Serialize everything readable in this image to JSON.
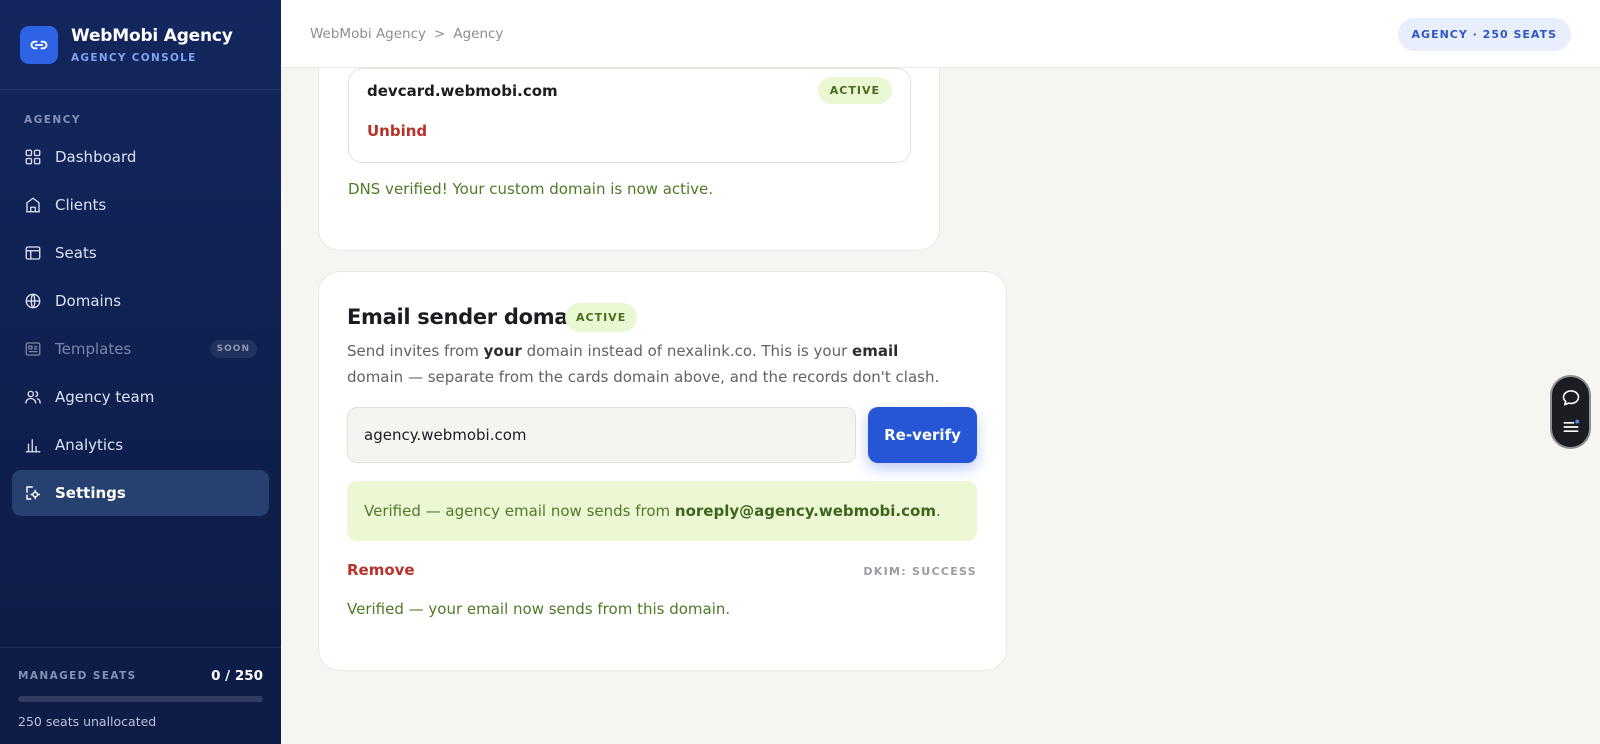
{
  "brand": {
    "name": "WebMobi Agency",
    "subtitle": "AGENCY CONSOLE"
  },
  "sidebar": {
    "section_label": "AGENCY",
    "items": [
      {
        "label": "Dashboard",
        "icon": "grid-icon"
      },
      {
        "label": "Clients",
        "icon": "building-icon"
      },
      {
        "label": "Seats",
        "icon": "layout-icon"
      },
      {
        "label": "Domains",
        "icon": "globe-icon"
      },
      {
        "label": "Templates",
        "icon": "template-icon",
        "badge": "SOON",
        "disabled": true
      },
      {
        "label": "Agency team",
        "icon": "users-icon"
      },
      {
        "label": "Analytics",
        "icon": "bar-chart-icon"
      },
      {
        "label": "Settings",
        "icon": "settings-icon",
        "active": true
      }
    ],
    "footer": {
      "label": "MANAGED SEATS",
      "count": "0 / 250",
      "fill_fraction": 0,
      "note": "250 seats unallocated"
    }
  },
  "header": {
    "breadcrumb": [
      "WebMobi Agency",
      "Agency"
    ],
    "breadcrumb_separator": ">",
    "plan_badge": "AGENCY · 250 SEATS"
  },
  "cards_domain": {
    "domain": "devcard.webmobi.com",
    "status": "ACTIVE",
    "unbind_label": "Unbind",
    "message": "DNS verified! Your custom domain is now active."
  },
  "email_domain": {
    "title": "Email sender domain",
    "status": "ACTIVE",
    "description_parts": [
      "Send invites from ",
      "your",
      " domain instead of nexalink.co. This is your ",
      "email",
      " domain — separate from the cards domain above, and the records don't clash."
    ],
    "input_value": "agency.webmobi.com",
    "reverify_label": "Re-verify",
    "verified_prefix": "Verified — agency email now sends from ",
    "verified_address": "noreply@agency.webmobi.com",
    "verified_suffix": ".",
    "remove_label": "Remove",
    "dkim_status": "DKIM: SUCCESS",
    "final_message": "Verified — your email now sends from this domain."
  },
  "colors": {
    "sidebar_bg": "#13275e",
    "accent": "#2656d6",
    "success_text": "#4f7a28",
    "success_bg": "#ebf8d3",
    "danger": "#b7332a"
  }
}
